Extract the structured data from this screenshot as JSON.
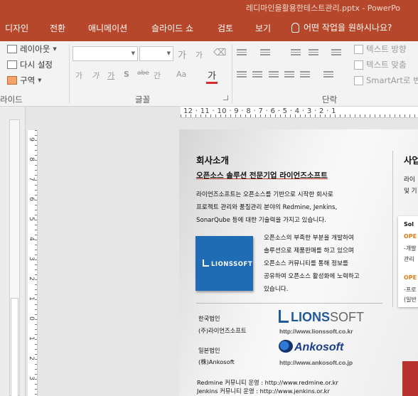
{
  "window": {
    "title": "레디마인을활용한테스트관리.pptx - PowerPo"
  },
  "tabs": [
    {
      "label": "디자인"
    },
    {
      "label": "전환"
    },
    {
      "label": "애니메이션"
    },
    {
      "label": "슬라이드 쇼"
    },
    {
      "label": "검토"
    },
    {
      "label": "보기"
    }
  ],
  "tell_me": "어떤 작업을 원하시나요?",
  "ribbon": {
    "slides_group": {
      "layout": "레이아웃",
      "reset": "다시 설정",
      "section": "구역",
      "label": "라이드"
    },
    "font_group": {
      "label": "글꼴",
      "grow": "가",
      "shrink": "가",
      "buttons": [
        "가",
        "가",
        "가",
        "S",
        "abe",
        "간",
        "Aa",
        "가"
      ],
      "spacing": "AV"
    },
    "paragraph_group": {
      "label": "단락",
      "text_direction": "텍스트 방향",
      "align_text": "텍스트 맞춤",
      "smartart": "SmartArt로 변"
    }
  },
  "ruler": {
    "h_numbers": "12 · 11 · 10 · 9 · 8 · 7 · 6 · 5 · 4 · 3 · 2 · 1",
    "v_numbers": [
      "9",
      "8",
      "7",
      "6",
      "5",
      "4",
      "3",
      "2",
      "1",
      "0",
      "1",
      "2",
      "3"
    ]
  },
  "slide": {
    "heading": "회사소개",
    "subheading": "오픈소스 솔루션 전문기업 라이언즈소프트",
    "intro": "라이언즈소프트는 오픈소스를 기반으로 시작한 회사로\n프로젝트 관리와 품질관리 분야의 Redmine, Jenkins,\nSonarQube 등에 대한 기술력을 가지고 있습니다.",
    "logo_text": "LIONSSOFT",
    "mission": "오픈소스의 부족한 부분을 개발하여\n솔루션으로 제품판매를 하고 있으며\n오픈소스 커뮤니티를 통해 정보를\n공유하여 오픈소스 활성화에 노력하고\n있습니다.",
    "korea_label": "한국법인",
    "korea_company": "(주)라이언즈소프트",
    "korea_brand": "LIONS",
    "korea_brand_suffix": "SOFT",
    "korea_url": "http://www.lionssoft.co.kr",
    "japan_label": "일본법인",
    "japan_company": "(株)Ankosoft",
    "japan_brand": "Ankosoft",
    "japan_url": "http://www.ankosoft.co.jp",
    "community1": "Redmine 커뮤니티 운영 : http://www.redmine.or.kr",
    "community2": "Jenkins 커뮤니티 운영 : http://www.jenkins.or.kr",
    "right_title": "사업",
    "right_line1": "라이",
    "right_line2": "및 기",
    "card_lines": [
      "Sol",
      "OPE",
      "-개발",
      "관리",
      "OPE",
      "-프로",
      "(일반"
    ]
  }
}
